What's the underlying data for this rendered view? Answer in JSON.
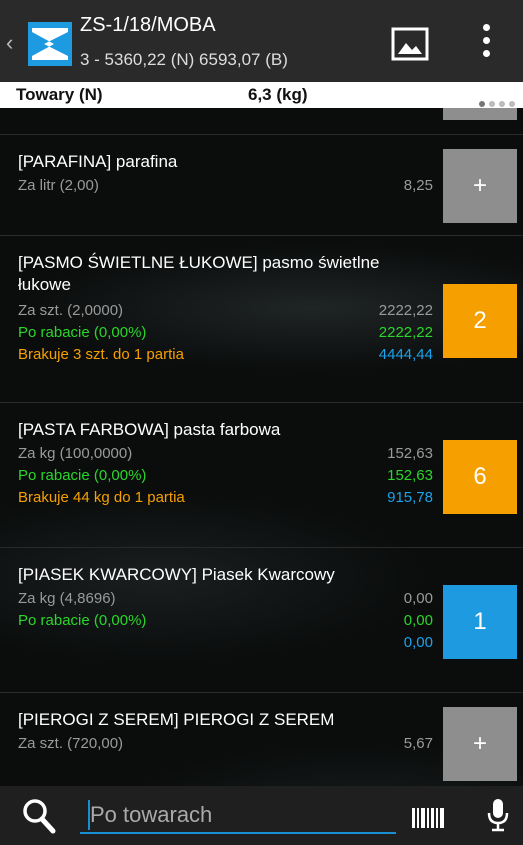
{
  "header": {
    "title": "ZS-1/18/MOBA",
    "subtitle": "3 - 5360,22 (N) 6593,07 (B)"
  },
  "summary": {
    "label": "Towary (N)",
    "weight": "6,3 (kg)"
  },
  "items": [
    {
      "name": "[PARAFINA] parafina",
      "lines": [
        {
          "text": "Za litr (2,00)",
          "value": "8,25"
        }
      ],
      "qty": "+"
    },
    {
      "name": "[PASMO ŚWIETLNE ŁUKOWE] pasmo świetlne łukowe",
      "lines": [
        {
          "text": "Za szt. (2,0000)",
          "value": "2222,22"
        },
        {
          "text": "Po rabacie (0,00%)",
          "value": "2222,22"
        },
        {
          "text": "Brakuje 3 szt. do 1 partia",
          "value": "4444,44"
        }
      ],
      "qty": "2"
    },
    {
      "name": "[PASTA FARBOWA] pasta farbowa",
      "lines": [
        {
          "text": "Za kg (100,0000)",
          "value": "152,63"
        },
        {
          "text": "Po rabacie (0,00%)",
          "value": "152,63"
        },
        {
          "text": "Brakuje 44 kg do 1 partia",
          "value": "915,78"
        }
      ],
      "qty": "6"
    },
    {
      "name": "[PIASEK KWARCOWY] Piasek Kwarcowy",
      "lines": [
        {
          "text": "Za kg (4,8696)",
          "value": "0,00"
        },
        {
          "text": "Po rabacie (0,00%)",
          "value": "0,00"
        },
        {
          "text": "",
          "value": "0,00"
        }
      ],
      "qty": "1"
    },
    {
      "name": "[PIEROGI  Z SEREM] PIEROGI  Z SEREM",
      "lines": [
        {
          "text": "Za szt. (720,00)",
          "value": "5,67"
        }
      ],
      "qty": "+"
    }
  ],
  "search": {
    "placeholder": "Po towarach"
  },
  "colors": {
    "green": "#2bd62b",
    "orange": "#f5a000",
    "blue": "#1aa3e8",
    "add_button": "#8e8e8e"
  }
}
